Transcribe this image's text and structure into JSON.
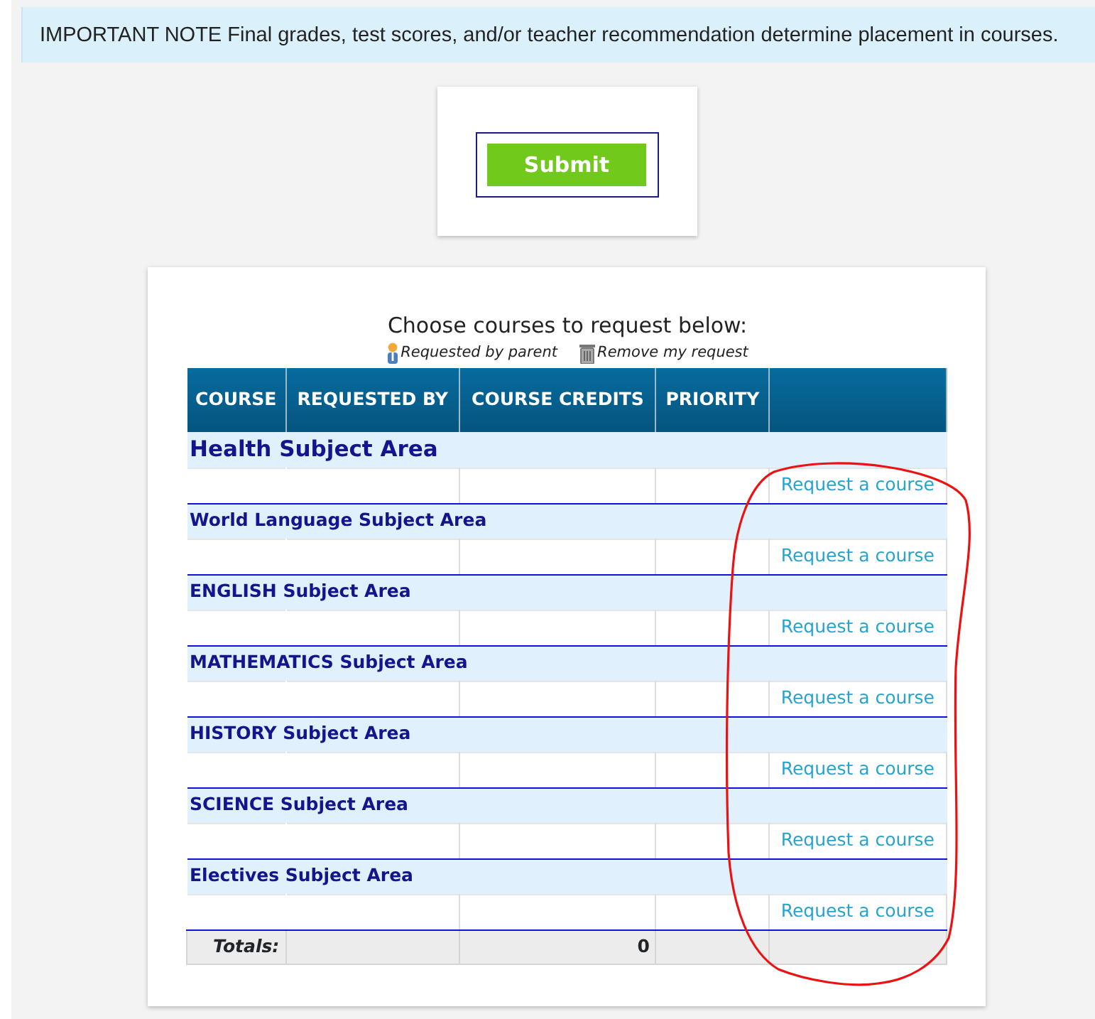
{
  "note": {
    "text": "IMPORTANT NOTE Final grades, test scores, and/or teacher recommendation determine placement in courses."
  },
  "submit_button": {
    "label": "Submit"
  },
  "course_table": {
    "title": "Choose courses to request below:",
    "legend": [
      {
        "kind": "parent",
        "label": "Requested by parent"
      },
      {
        "kind": "remove",
        "label": "Remove my request"
      }
    ],
    "columns": [
      "COURSE",
      "REQUESTED BY",
      "COURSE CREDITS",
      "PRIORITY"
    ],
    "subject_areas": [
      {
        "name": "Health Subject Area",
        "emphasized": true,
        "link": "Request a course"
      },
      {
        "name": "World Language Subject Area",
        "emphasized": false,
        "link": "Request a course"
      },
      {
        "name": "ENGLISH Subject Area",
        "emphasized": false,
        "link": "Request a course"
      },
      {
        "name": "MATHEMATICS Subject Area",
        "emphasized": false,
        "link": "Request a course"
      },
      {
        "name": "HISTORY Subject Area",
        "emphasized": false,
        "link": "Request a course"
      },
      {
        "name": "SCIENCE Subject Area",
        "emphasized": false,
        "link": "Request a course"
      },
      {
        "name": "Electives Subject Area",
        "emphasized": false,
        "link": "Request a course"
      }
    ],
    "totals": {
      "label": "Totals:",
      "credits": "0"
    }
  },
  "annotation": {
    "kind": "freehand-loop"
  }
}
